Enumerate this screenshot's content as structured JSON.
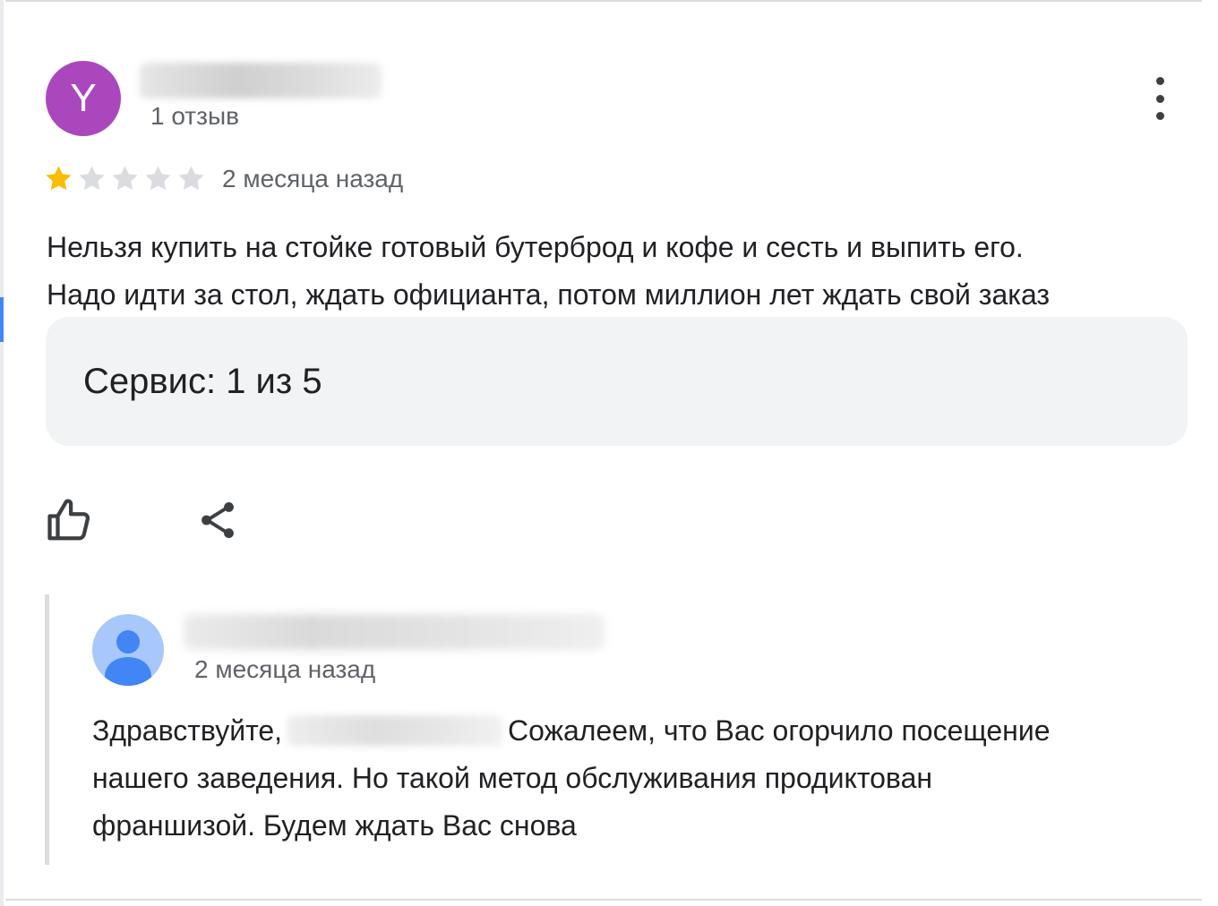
{
  "review": {
    "avatar_letter": "Y",
    "avatar_color": "#ab47bc",
    "review_count": "1 отзыв",
    "rating": {
      "value": 1,
      "max": 5
    },
    "time_ago": "2 месяца назад",
    "text_line1": "Нельзя купить на стойке готовый бутерброд и кофе и сесть и выпить его.",
    "text_line2": "Надо идти за стол, ждать официанта, потом миллион лет ждать свой заказ",
    "service_rating": "Сервис: 1 из 5",
    "icons": {
      "more": "more-vert-icon",
      "like": "thumb-up-icon",
      "share": "share-icon"
    }
  },
  "owner_reply": {
    "time_ago": "2 месяца назад",
    "text_greeting": "Здравствуйте,",
    "text_after_name": "Сожалеем, что Вас огорчило посещение",
    "text_line2": "нашего заведения. Но такой метод обслуживания продиктован",
    "text_line3": "франшизой. Будем ждать Вас снова",
    "avatar_color": "#a8c7fa",
    "avatar_figure_color": "#4285f4"
  },
  "colors": {
    "star_filled": "#fbbc04",
    "star_empty": "#dadce0"
  }
}
